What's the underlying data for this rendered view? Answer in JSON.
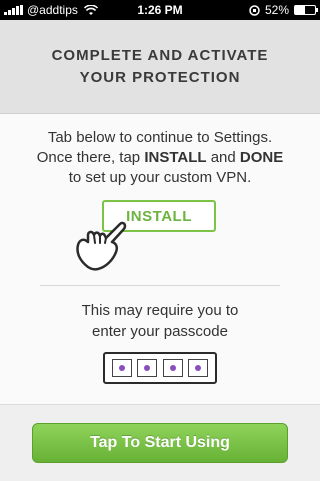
{
  "status_bar": {
    "carrier": "@addtips",
    "time": "1:26 PM",
    "battery": "52%",
    "battery_level": 0.52
  },
  "header": {
    "title": "COMPLETE AND ACTIVATE YOUR PROTECTION"
  },
  "instructions": {
    "line1": "Tab below to continue to Settings.",
    "line2_prefix": "Once there, tap ",
    "install_word": "INSTALL",
    "and_word": " and ",
    "done_word": "DONE",
    "line3": "to set up your custom VPN."
  },
  "install_button": {
    "label": "INSTALL"
  },
  "passcode": {
    "line1": "This may require you to",
    "line2": "enter your passcode",
    "digits": 4
  },
  "footer": {
    "start_label": "Tap To Start Using"
  },
  "colors": {
    "accent_green": "#7cc445",
    "passcode_dot": "#8a4fbf"
  }
}
